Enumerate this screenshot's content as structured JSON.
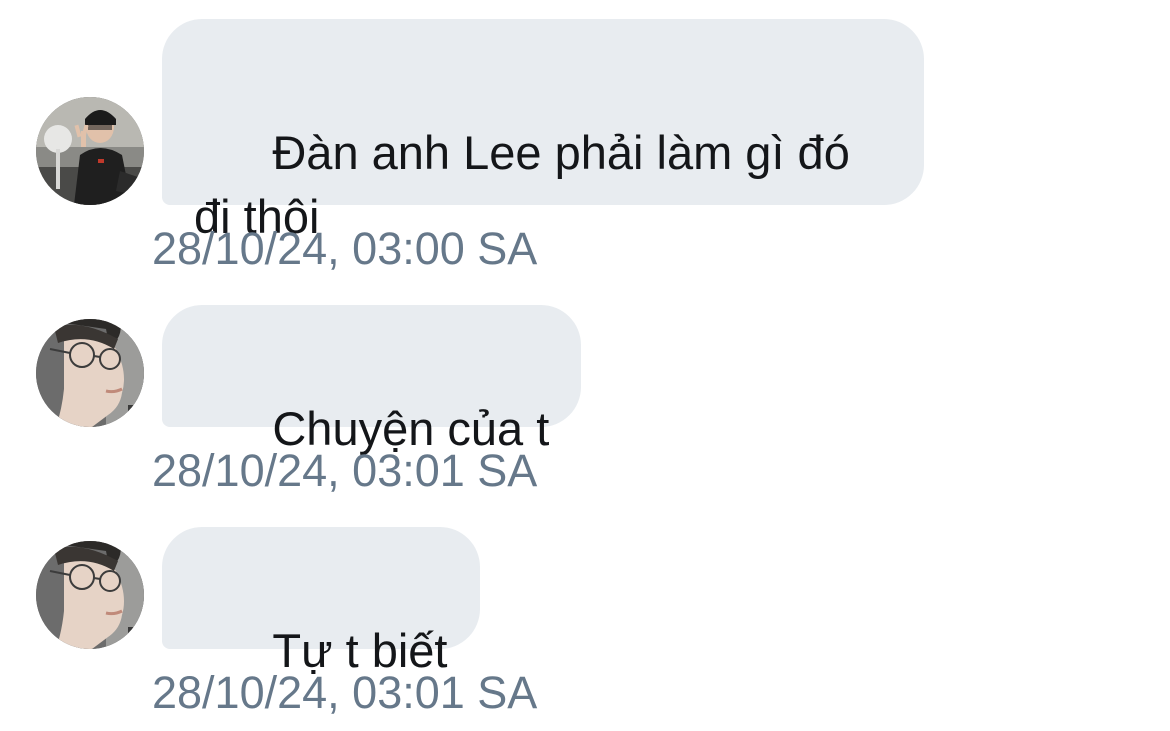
{
  "messages": [
    {
      "avatar": "user-photo-peace-sign",
      "text": "Đàn anh Lee phải làm gì đó\nđi thôi",
      "time": "28/10/24, 03:00 SA"
    },
    {
      "avatar": "user-photo-glasses-profile",
      "text": "Chuyện của t",
      "time": "28/10/24, 03:01 SA"
    },
    {
      "avatar": "user-photo-glasses-profile",
      "text": "Tự t biết",
      "time": "28/10/24, 03:01 SA"
    }
  ],
  "colors": {
    "bubble": "#e8ecf0",
    "text": "#141619",
    "timestamp": "#66788a",
    "background": "#ffffff"
  }
}
